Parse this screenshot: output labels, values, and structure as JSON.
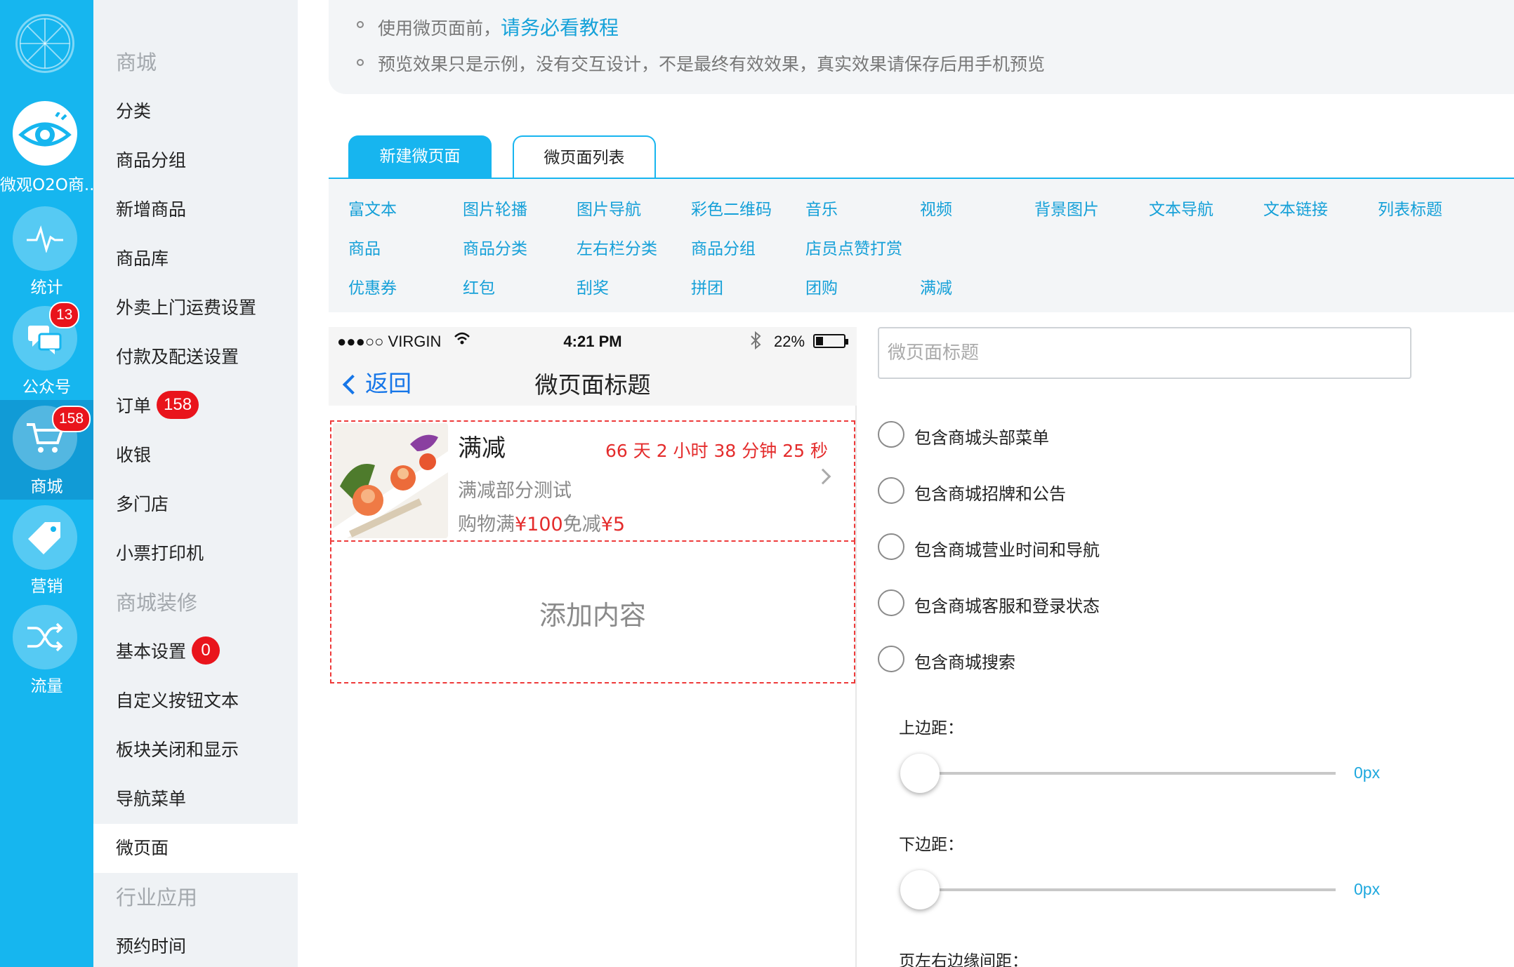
{
  "rail": {
    "items": [
      {
        "label": "微观O2O商...",
        "icon": "eye-logo-icon"
      },
      {
        "label": "统计",
        "icon": "pulse-icon"
      },
      {
        "label": "公众号",
        "icon": "chat-bubbles-icon",
        "badge": "13"
      },
      {
        "label": "商城",
        "icon": "cart-icon",
        "badge": "158"
      },
      {
        "label": "营销",
        "icon": "tag-icon"
      },
      {
        "label": "流量",
        "icon": "shuffle-icon"
      }
    ]
  },
  "menu": {
    "items": [
      {
        "label": "商城",
        "type": "section"
      },
      {
        "label": "分类"
      },
      {
        "label": "商品分组"
      },
      {
        "label": "新增商品"
      },
      {
        "label": "商品库"
      },
      {
        "label": "外卖上门运费设置"
      },
      {
        "label": "付款及配送设置"
      },
      {
        "label": "订单",
        "badge": "158"
      },
      {
        "label": "收银"
      },
      {
        "label": "多门店"
      },
      {
        "label": "小票打印机"
      },
      {
        "label": "商城装修",
        "type": "section"
      },
      {
        "label": "基本设置",
        "badge": "0"
      },
      {
        "label": "自定义按钮文本"
      },
      {
        "label": "板块关闭和显示"
      },
      {
        "label": "导航菜单"
      },
      {
        "label": "微页面",
        "active": true
      },
      {
        "label": "行业应用",
        "type": "section"
      },
      {
        "label": "预约时间"
      }
    ]
  },
  "notice": {
    "line1_text": "使用微页面前，",
    "line1_link": "请务必看教程",
    "line2_text": "预览效果只是示例，没有交互设计，不是最终有效效果，真实效果请保存后用手机预览"
  },
  "tabs": {
    "new_page": "新建微页面",
    "page_list": "微页面列表"
  },
  "widgets": [
    [
      "富文本",
      "图片轮播",
      "图片导航",
      "彩色二维码",
      "音乐",
      "视频",
      "背景图片",
      "文本导航",
      "文本链接",
      "列表标题"
    ],
    [
      "商品",
      "商品分类",
      "左右栏分类",
      "商品分组",
      "店员点赞打赏"
    ],
    [
      "优惠券",
      "红包",
      "刮奖",
      "拼团",
      "团购",
      "满减"
    ]
  ],
  "phone": {
    "carrier": "●●●○○ VIRGIN",
    "time": "4:21 PM",
    "battery": "22%",
    "back_label": "返回",
    "title": "微页面标题",
    "card": {
      "title": "满减",
      "countdown": "66 天 2 小时 38 分钟 25 秒",
      "subtitle": "满减部分测试",
      "offer_prefix": "购物满",
      "offer_amount": "¥100",
      "offer_mid": "免减",
      "offer_discount": "¥5"
    },
    "add_content": "添加内容"
  },
  "settings": {
    "title_placeholder": "微页面标题",
    "options": [
      "包含商城头部菜单",
      "包含商城招牌和公告",
      "包含商城营业时间和导航",
      "包含商城客服和登录状态",
      "包含商城搜索"
    ],
    "top_margin_label": "上边距：",
    "top_margin_value": "0px",
    "bottom_margin_label": "下边距：",
    "bottom_margin_value": "0px",
    "side_margin_label": "页左右边缘间距："
  },
  "colors": {
    "rail_blue": "#16b6ef",
    "link_blue": "#15a0d8",
    "badge_red": "#e9141c",
    "countdown_red": "#e42c2c"
  }
}
